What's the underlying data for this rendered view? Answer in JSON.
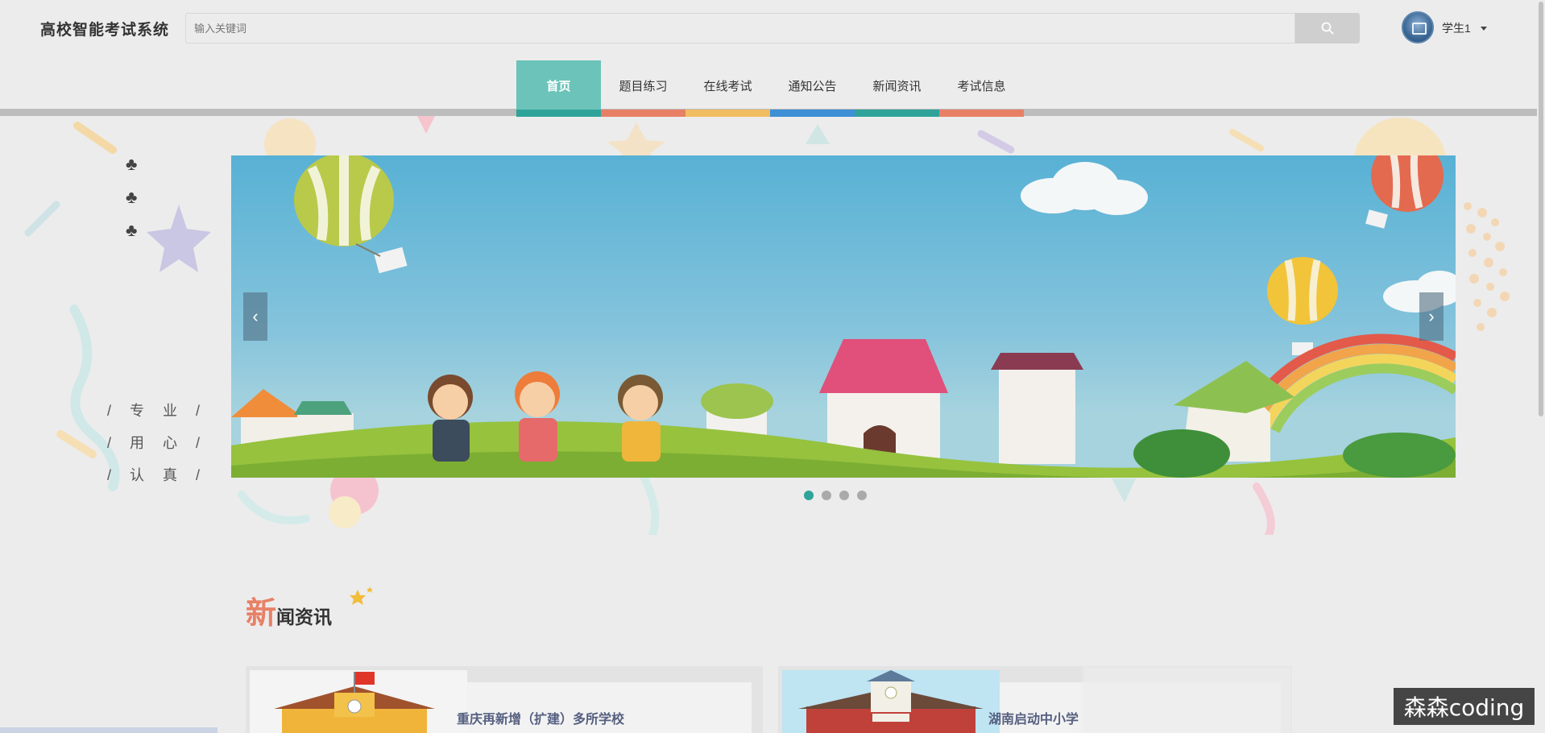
{
  "header": {
    "site_title": "高校智能考试系统",
    "search_placeholder": "输入关键词",
    "search_icon": "search-icon",
    "user_name": "学生1"
  },
  "nav": {
    "items": [
      {
        "label": "首页",
        "color": "#2fa39a",
        "active": true
      },
      {
        "label": "题目练习",
        "color": "#e88066"
      },
      {
        "label": "在线考试",
        "color": "#f1bd61"
      },
      {
        "label": "通知公告",
        "color": "#3d8fd6"
      },
      {
        "label": "新闻资讯",
        "color": "#2fa39a"
      },
      {
        "label": "考试信息",
        "color": "#e88066"
      }
    ]
  },
  "sidebar_slogan": {
    "clubs": [
      "♣",
      "♣",
      "♣"
    ],
    "lines": [
      "/ 专 业 /",
      "/ 用 心 /",
      "/ 认 真 /"
    ]
  },
  "carousel": {
    "prev_label": "‹",
    "next_label": "›",
    "slide_count": 4,
    "active_index": 0
  },
  "news": {
    "title_first_char": "新",
    "title_rest": "闻资讯",
    "items": [
      {
        "title": "重庆再新增（扩建）多所学校"
      },
      {
        "title": "湖南启动中小学"
      }
    ]
  },
  "watermark": "森森coding"
}
